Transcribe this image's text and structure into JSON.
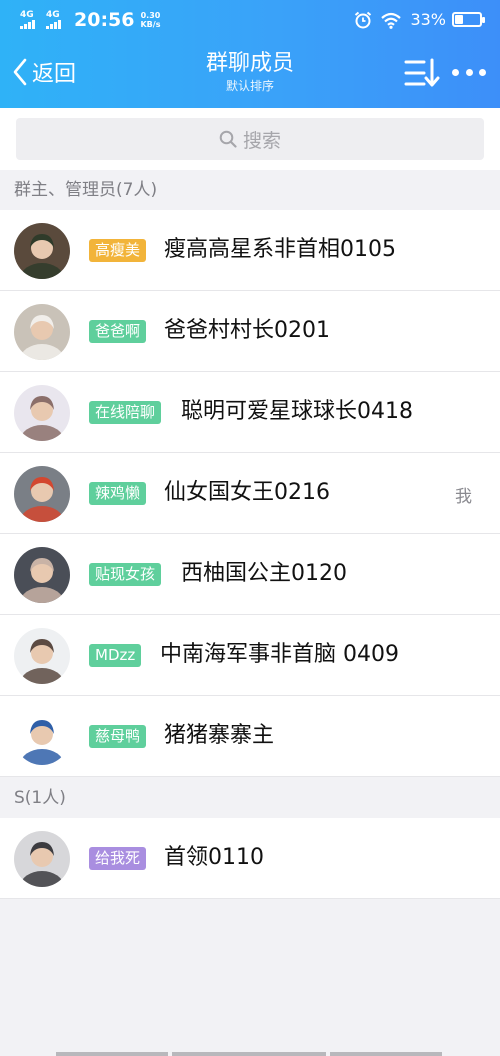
{
  "status_bar": {
    "sim1": "4G",
    "sim2": "4G",
    "time": "20:56",
    "speed_value": "0.30",
    "speed_unit": "KB/s",
    "battery_text": "33%",
    "battery_level": 0.33
  },
  "nav": {
    "back_label": "返回",
    "title": "群聊成员",
    "subtitle": "默认排序"
  },
  "search": {
    "placeholder": "搜索"
  },
  "sections": [
    {
      "title": "群主、管理员(7人)",
      "members": [
        {
          "badge": "高瘦美",
          "badge_color": "#f2b43a",
          "name": "瘦高高星系非首相0105",
          "avatar_bg": "#5a4a3c",
          "avatar_fg": "#2f3b2a"
        },
        {
          "badge": "爸爸啊",
          "badge_color": "#5fcf9c",
          "name": "爸爸村村长0201",
          "avatar_bg": "#c9c2b8",
          "avatar_fg": "#f1eeea"
        },
        {
          "badge": "在线陪聊",
          "badge_color": "#5fcf9c",
          "name": "聪明可爱星球球长0418",
          "avatar_bg": "#e9e6ee",
          "avatar_fg": "#8b6f6a"
        },
        {
          "badge": "辣鸡懒",
          "badge_color": "#5fcf9c",
          "name": "仙女国女王0216",
          "avatar_bg": "#7a7f86",
          "avatar_fg": "#d3472f",
          "me": "我"
        },
        {
          "badge": "贴现女孩",
          "badge_color": "#5fcf9c",
          "name": "西柚国公主0120",
          "avatar_bg": "#4a4e57",
          "avatar_fg": "#c9b3a6"
        },
        {
          "badge": "MDzz",
          "badge_color": "#5fcf9c",
          "name": "中南海军事非首脑 0409",
          "avatar_bg": "#eef0f2",
          "avatar_fg": "#5b4a42"
        },
        {
          "badge": "慈母鸭",
          "badge_color": "#5fcf9c",
          "name": "猪猪寨寨主",
          "avatar_bg": "#ffffff",
          "avatar_fg": "#2f5fa8"
        }
      ]
    },
    {
      "title": "S(1人)",
      "members": [
        {
          "badge": "给我死",
          "badge_color": "#a98ee0",
          "name": "首领0110",
          "avatar_bg": "#d7d7da",
          "avatar_fg": "#3c3c40"
        }
      ]
    }
  ],
  "icons": {
    "back": "chevron-left-icon",
    "sort": "sort-icon",
    "more": "more-dots-icon",
    "search": "search-icon",
    "alarm": "alarm-icon",
    "wifi": "wifi-icon",
    "battery": "battery-icon"
  }
}
